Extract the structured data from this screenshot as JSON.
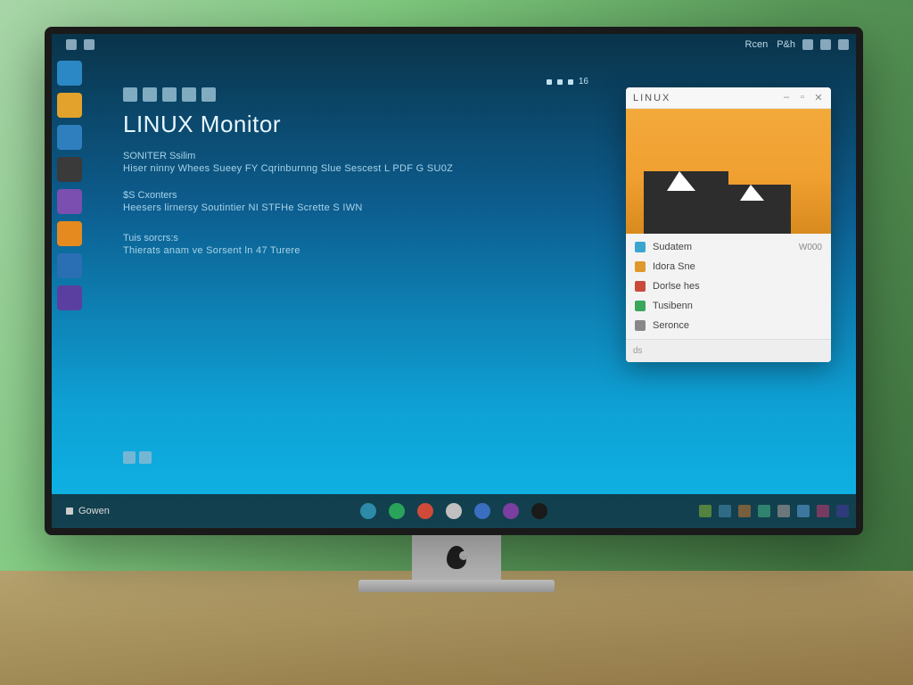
{
  "menubar": {
    "left_label": "",
    "right_items": [
      "Rcen",
      "P&h"
    ]
  },
  "desktop_icons": [
    {
      "name": "app-icon-1",
      "color": "#2b88c4"
    },
    {
      "name": "app-icon-2",
      "color": "#e2a22b"
    },
    {
      "name": "app-icon-3",
      "color": "#2f7fbf"
    },
    {
      "name": "app-icon-4",
      "color": "#3a3a3a"
    },
    {
      "name": "app-icon-5",
      "color": "#7a4fb0"
    },
    {
      "name": "app-icon-6",
      "color": "#e58a1f"
    },
    {
      "name": "app-icon-7",
      "color": "#2a6fb3"
    },
    {
      "name": "app-icon-8",
      "color": "#5a3fa0"
    }
  ],
  "main": {
    "title": "LINUX Monitor",
    "sections": [
      {
        "label": "SONITER Ssilim",
        "text": "Hiser ninny Whees Sueey FY Cqrinburnng Slue Sescest L PDF G  SU0Z"
      },
      {
        "label": "$S Cxonters",
        "text": "Heesers lirnersy Soutintier NI STFHe Scrette  S IWN"
      },
      {
        "label": "Tuis sorcrs:s",
        "text": "Thierats anam ve Sorsent ln 47 Turere"
      }
    ],
    "indicator_text": "16"
  },
  "side_window": {
    "title": "LINUX",
    "window_controls": {
      "minimize": "–",
      "maximize": "▫",
      "close": "✕"
    },
    "items": [
      {
        "icon_color": "#3aa6d0",
        "label": "Sudatem",
        "value": "W000"
      },
      {
        "icon_color": "#e0982b",
        "label": "Idora Sne",
        "value": ""
      },
      {
        "icon_color": "#c94a3a",
        "label": "Dorlse hes",
        "value": ""
      },
      {
        "icon_color": "#3aa65a",
        "label": "Tusibenn",
        "value": ""
      },
      {
        "icon_color": "#888888",
        "label": "Seronce",
        "value": ""
      }
    ],
    "footer": "ds"
  },
  "taskbar": {
    "start_label": "Gowen",
    "apps": [
      {
        "name": "app-a",
        "color": "#2d8aa8"
      },
      {
        "name": "app-b",
        "color": "#2aa35a"
      },
      {
        "name": "app-c",
        "color": "#d04a3a"
      },
      {
        "name": "app-d",
        "color": "#c0c0c0"
      },
      {
        "name": "app-e",
        "color": "#3a6fbf"
      },
      {
        "name": "app-f",
        "color": "#7a3fa0"
      },
      {
        "name": "app-g",
        "color": "#1a1a1a"
      }
    ],
    "tray": [
      {
        "name": "tray-1",
        "color": "#6a9a3a"
      },
      {
        "name": "tray-2",
        "color": "#3a7a9a"
      },
      {
        "name": "tray-3",
        "color": "#9a6a3a"
      },
      {
        "name": "tray-4",
        "color": "#3a9a7a"
      },
      {
        "name": "tray-5",
        "color": "#8a8a8a"
      },
      {
        "name": "tray-6",
        "color": "#4a8aba"
      },
      {
        "name": "tray-7",
        "color": "#9a3a6a"
      },
      {
        "name": "tray-8",
        "color": "#3a3a8a"
      }
    ]
  },
  "colors": {
    "desktop_gradient_top": "#09344a",
    "desktop_gradient_bottom": "#0fb6e8",
    "hero_orange": "#f0a030",
    "mountain": "#2d2d2d"
  }
}
